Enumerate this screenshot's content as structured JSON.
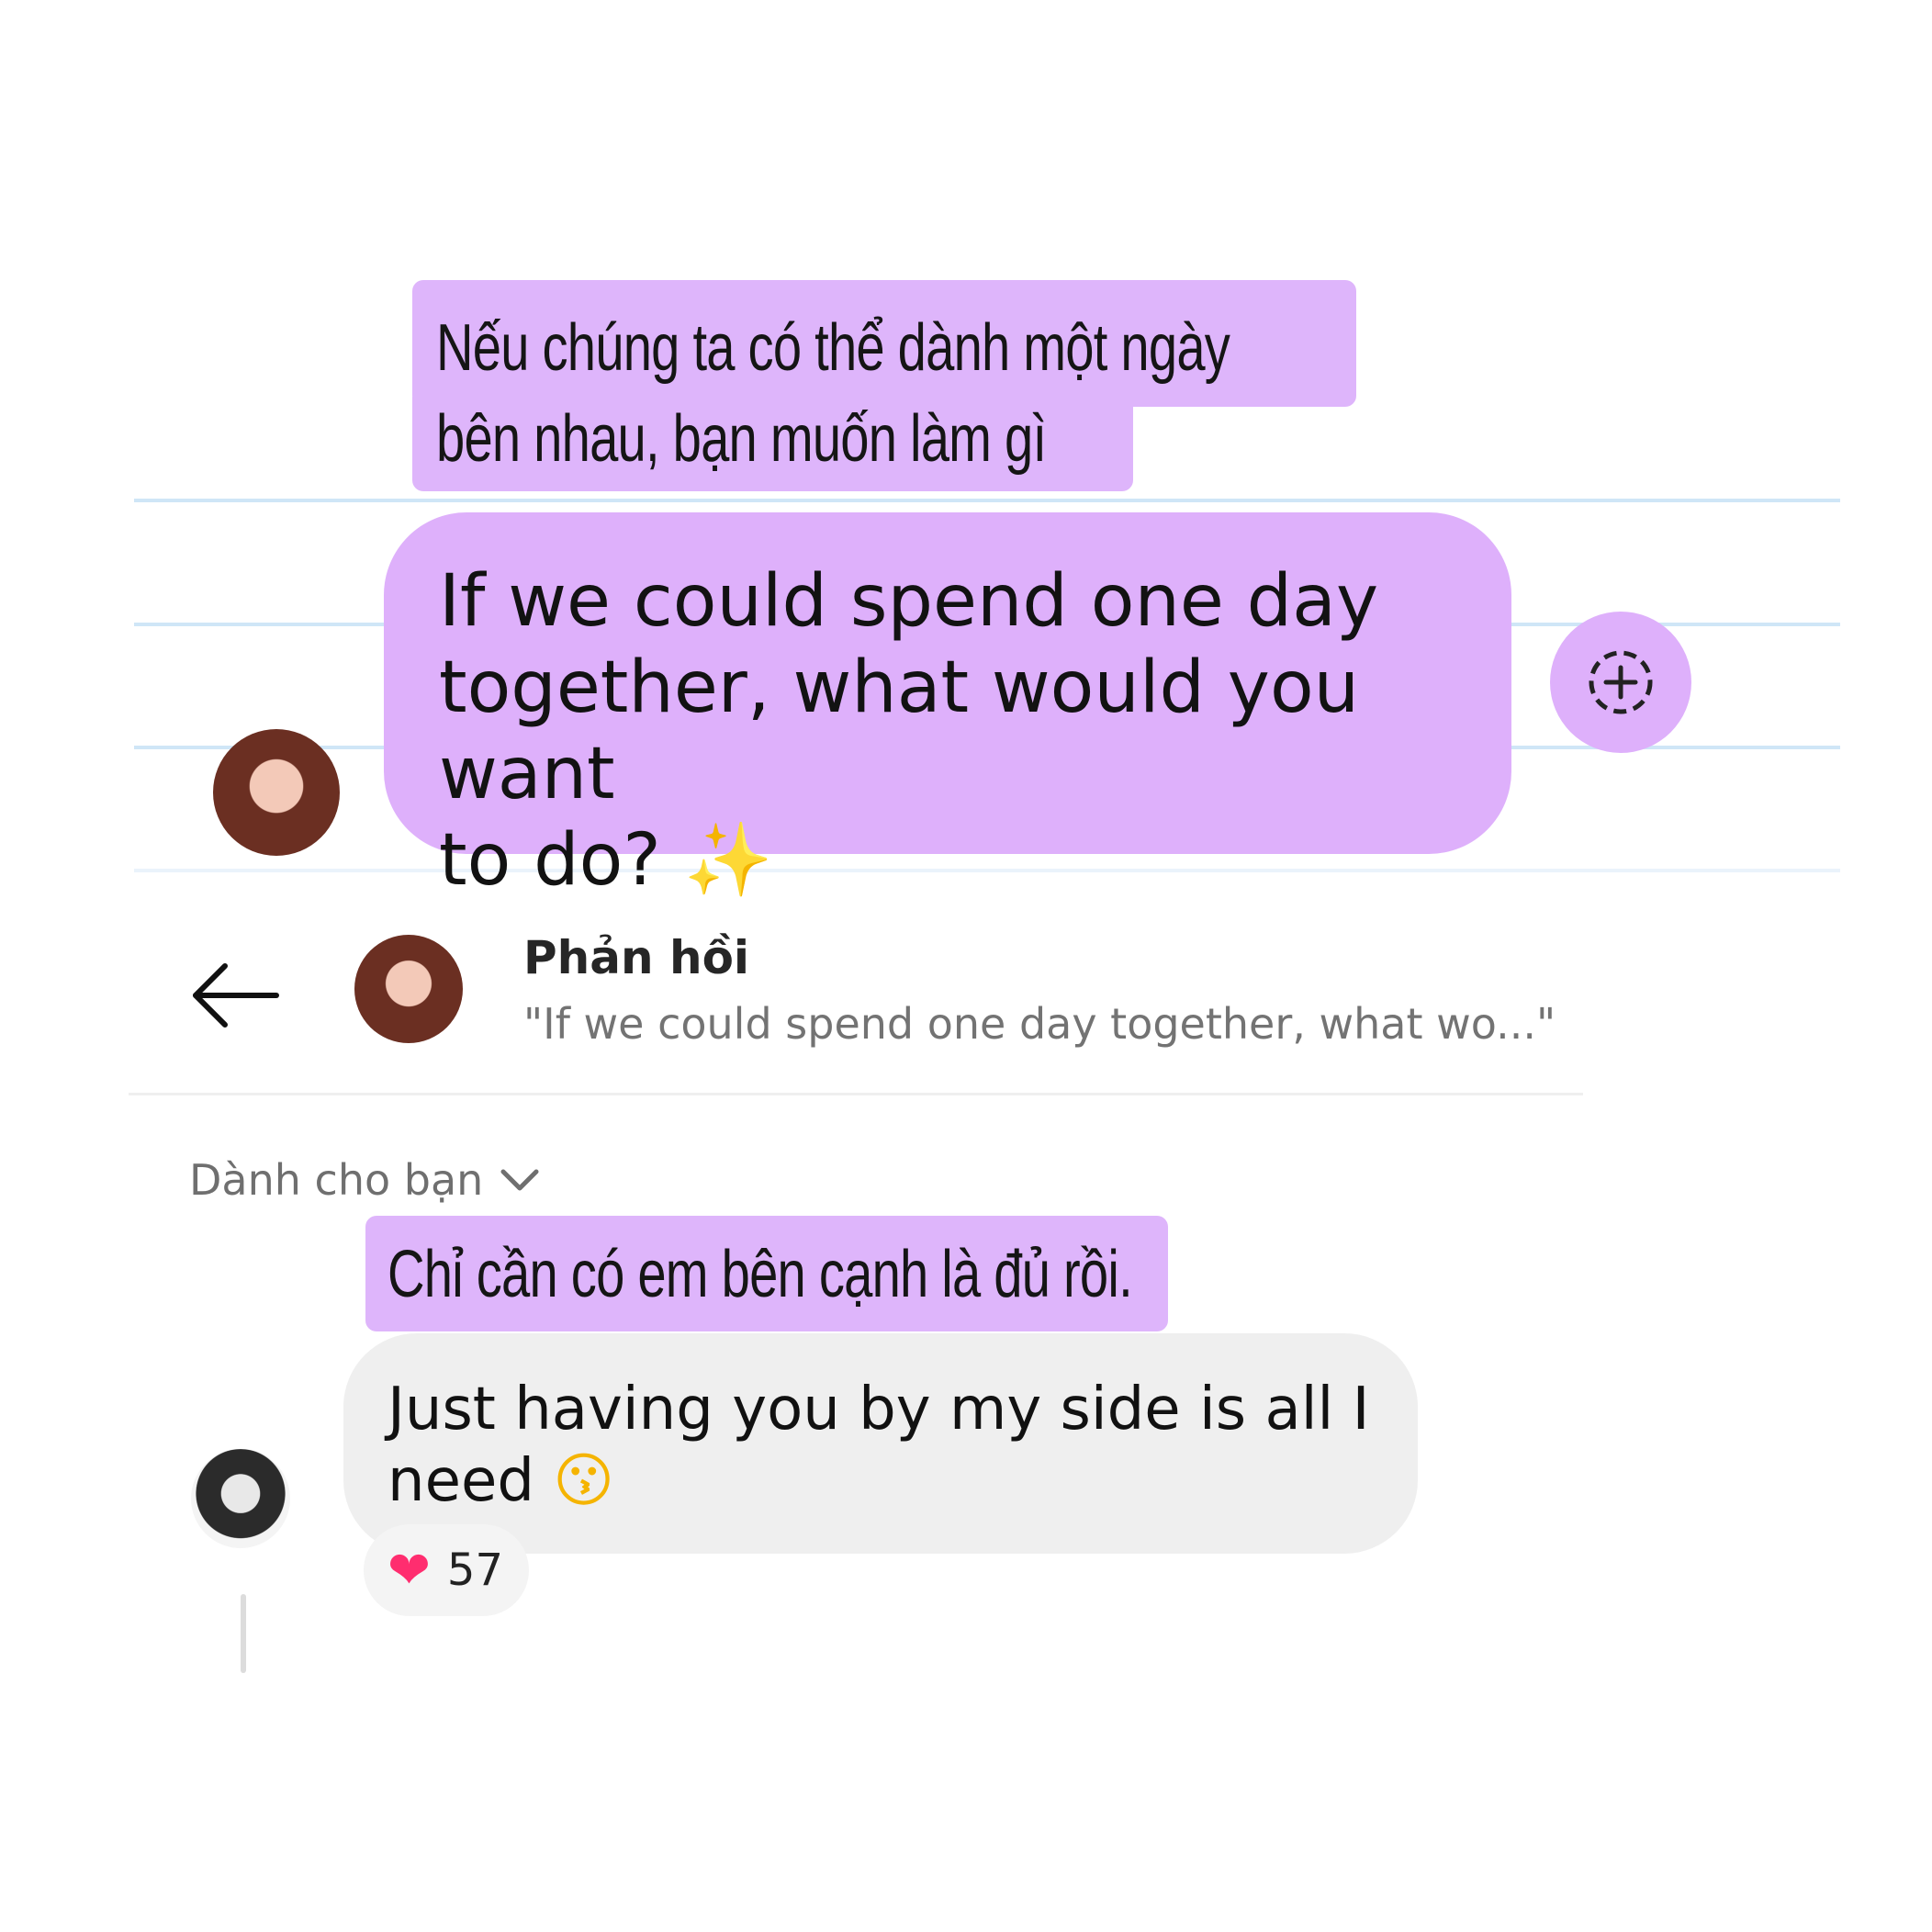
{
  "top_note": {
    "vi_caption_line1": "Nếu chúng ta có thể dành một ngày",
    "vi_caption_line2": "bên nhau, bạn muốn làm gì",
    "en_line1": "If we could spend one day",
    "en_line2": "together, what would you want",
    "en_line3": "to do?",
    "en_emoji": "✨",
    "add_icon": "add-plus-icon"
  },
  "reply_header": {
    "back_icon": "arrow-left-icon",
    "title": "Phản hồi",
    "quote": "\"If we could spend one day together, what wo...\""
  },
  "comments": {
    "filter_label": "Dành cho bạn",
    "filter_icon": "chevron-down-icon",
    "vi_caption": "Chỉ cần có em bên cạnh là đủ rồi.",
    "en_line1": "Just having you by my side is all I",
    "en_line2": "need",
    "en_emoji": "😗",
    "reaction_emoji": "❤",
    "reaction_count": "57"
  },
  "colors": {
    "bubble_purple": "#deb0fb",
    "ruled_line": "#cfe6f7",
    "comment_bubble": "#efefef"
  }
}
